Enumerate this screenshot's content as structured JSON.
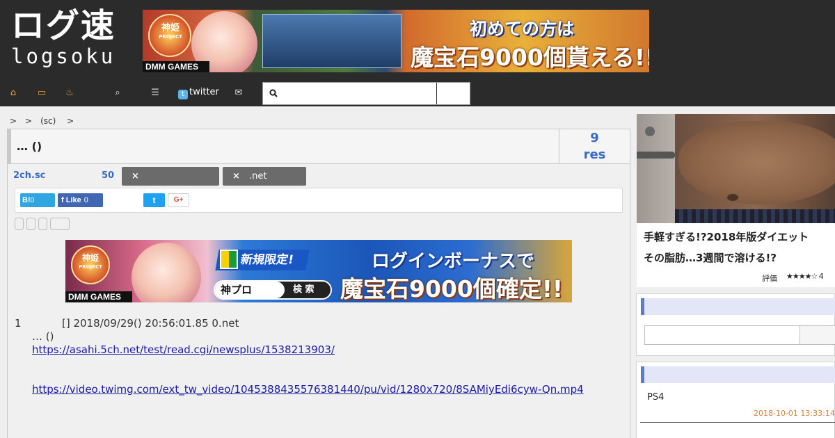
{
  "logo": {
    "jp": "ログ速",
    "en": "logsoku"
  },
  "top_banner": {
    "brand_line1": "神姫",
    "brand_line2": "PROJECT",
    "publisher": "DMM GAMES",
    "headline": "初めての方は",
    "subline": "魔宝石9000個貰える!!"
  },
  "nav": {
    "twitter_label": "twitter",
    "search_placeholder": ""
  },
  "breadcrumb": ">　>　(sc)　 >",
  "article": {
    "title": "… ()",
    "res_count": "9",
    "res_label": "res",
    "source": "2ch.sc",
    "count": "50",
    "tags": [
      "",
      ".net"
    ]
  },
  "share": {
    "hatena_label": "B!",
    "hatena_count": "0",
    "fb_label": "Like",
    "fb_count": "0",
    "twitter_symbol": "t",
    "gplus_label": "G+"
  },
  "mid_banner": {
    "brand_line1": "神姫",
    "brand_line2": "PROJECT",
    "publisher": "DMM GAMES",
    "tag": "新規限定!",
    "headline": "ログインボーナスで",
    "subline": "魔宝石9000個確定!!",
    "search_term": "神プロ",
    "search_button": "検 索"
  },
  "post": {
    "number": "1",
    "meta": "[] 2018/09/29() 20:56:01.85 0.net",
    "title": "… ()",
    "links": [
      "https://asahi.5ch.net/test/read.cgi/newsplus/1538213903/",
      "https://video.twimg.com/ext_tw_video/1045388435576381440/pu/vid/1280x720/8SAMiyEdi6cyw-Qn.mp4"
    ]
  },
  "side_ad": {
    "title_line1": "手軽すぎる!?2018年版ダイエット",
    "title_line2": "その脂肪…3週間で溶ける!?",
    "rating_label": "評価",
    "stars": "★★★★☆ 4"
  },
  "side_news": {
    "item": "PS4",
    "date": "2018-10-01 13:33:14"
  },
  "colors": {
    "header_bg": "#2b2b2b",
    "link_blue": "#3a6bc4",
    "accent_orange": "#f2a13a",
    "sidebar_header": "#e3e6f7"
  }
}
